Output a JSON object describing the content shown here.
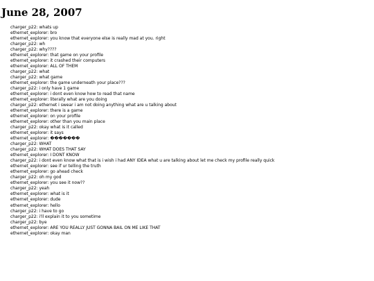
{
  "date_heading": "June 28, 2007",
  "messages": [
    {
      "sender": "charger_p22",
      "text": "whats up"
    },
    {
      "sender": "ethernet_explorer",
      "text": "bro"
    },
    {
      "sender": "ethernet_explorer",
      "text": "you know that everyone else is really mad at you. right"
    },
    {
      "sender": "charger_p22",
      "text": "wh"
    },
    {
      "sender": "charger_p22",
      "text": "why????"
    },
    {
      "sender": "ethernet_explorer",
      "text": "that game on your profile"
    },
    {
      "sender": "ethernet_explorer",
      "text": "it crashed their computers"
    },
    {
      "sender": "ethernet_explorer",
      "text": "ALL OF THEM"
    },
    {
      "sender": "charger_p22",
      "text": "what"
    },
    {
      "sender": "charger_p22",
      "text": "what game"
    },
    {
      "sender": "ethernet_explorer",
      "text": "the game underneath your place???"
    },
    {
      "sender": "charger_p22",
      "text": "i only have 1 game"
    },
    {
      "sender": "ethernet_explorer",
      "text": "i dont even know how to read that name"
    },
    {
      "sender": "ethernet_explorer",
      "text": "literally what are you doing"
    },
    {
      "sender": "charger_p22",
      "text": "ethernet i swear i am not doing anything what are u talking about"
    },
    {
      "sender": "ethernet_explorer",
      "text": "there is a game"
    },
    {
      "sender": "ethernet_explorer",
      "text": "on your profile"
    },
    {
      "sender": "ethernet_explorer",
      "text": "other than you main place"
    },
    {
      "sender": "charger_p22",
      "text": "okay what is it called"
    },
    {
      "sender": "ethernet_explorer",
      "text": "it says"
    },
    {
      "sender": "ethernet_explorer",
      "text": "�������"
    },
    {
      "sender": "charger_p22",
      "text": "WHAT"
    },
    {
      "sender": "charger_p22",
      "text": "WHAT DOES THAT SAY"
    },
    {
      "sender": "ethernet_explorer",
      "text": "I DONT KNOW"
    },
    {
      "sender": "charger_p22",
      "text": "i dont even know what that is i wish i had ANY IDEA what u are talking about let me check my profile really quick"
    },
    {
      "sender": "ethernet_explorer",
      "text": "see if ur telling the truth"
    },
    {
      "sender": "ethernet_explorer",
      "text": "go ahead check"
    },
    {
      "sender": "charger_p22",
      "text": "oh my god"
    },
    {
      "sender": "ethernet_explorer",
      "text": "you see it now??"
    },
    {
      "sender": "charger_p22",
      "text": "yeah"
    },
    {
      "sender": "ethernet_explorer",
      "text": "what is it"
    },
    {
      "sender": "ethernet_explorer",
      "text": "dude"
    },
    {
      "sender": "ethernet_explorer",
      "text": "hello"
    },
    {
      "sender": "charger_p22",
      "text": "i have to go"
    },
    {
      "sender": "charger_p22",
      "text": "i'll explain it to you sometime"
    },
    {
      "sender": "charger_p22",
      "text": "bye"
    },
    {
      "sender": "ethernet_explorer",
      "text": "ARE YOU REALLY JUST GONNA BAIL ON ME LIKE THAT"
    },
    {
      "sender": "ethernet_explorer",
      "text": "okay man"
    }
  ]
}
